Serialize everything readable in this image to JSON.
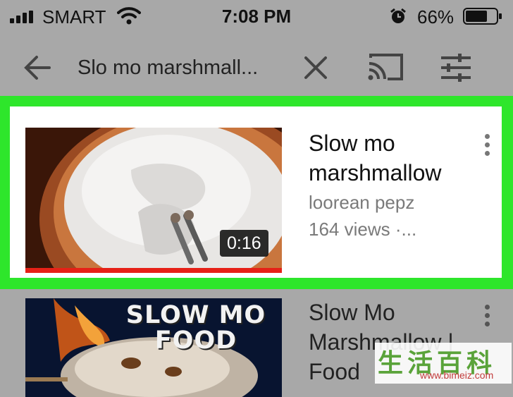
{
  "status_bar": {
    "carrier": "SMART",
    "time": "7:08 PM",
    "battery_percent": "66%",
    "icons": [
      "signal-icon",
      "wifi-icon",
      "alarm-icon",
      "battery-icon"
    ]
  },
  "toolbar": {
    "query": "Slo mo marshmall...",
    "icons": [
      "back-arrow-icon",
      "clear-icon",
      "cast-icon",
      "filter-icon"
    ]
  },
  "results": [
    {
      "title": "Slow mo marshmallow",
      "channel": "loorean pepz",
      "meta": "164 views ·...",
      "duration": "0:16",
      "highlighted": true
    },
    {
      "title": "Slow Mo Marshmallow | Food",
      "thumbnail_text": [
        "SLOW MO",
        "FOOD"
      ]
    }
  ],
  "watermark": {
    "glyphs": "生活百科",
    "url": "www.bimeiz.com"
  },
  "colors": {
    "highlight": "#2ee62b",
    "progress": "#e62117",
    "dim_overlay": "#a8a8a8"
  }
}
